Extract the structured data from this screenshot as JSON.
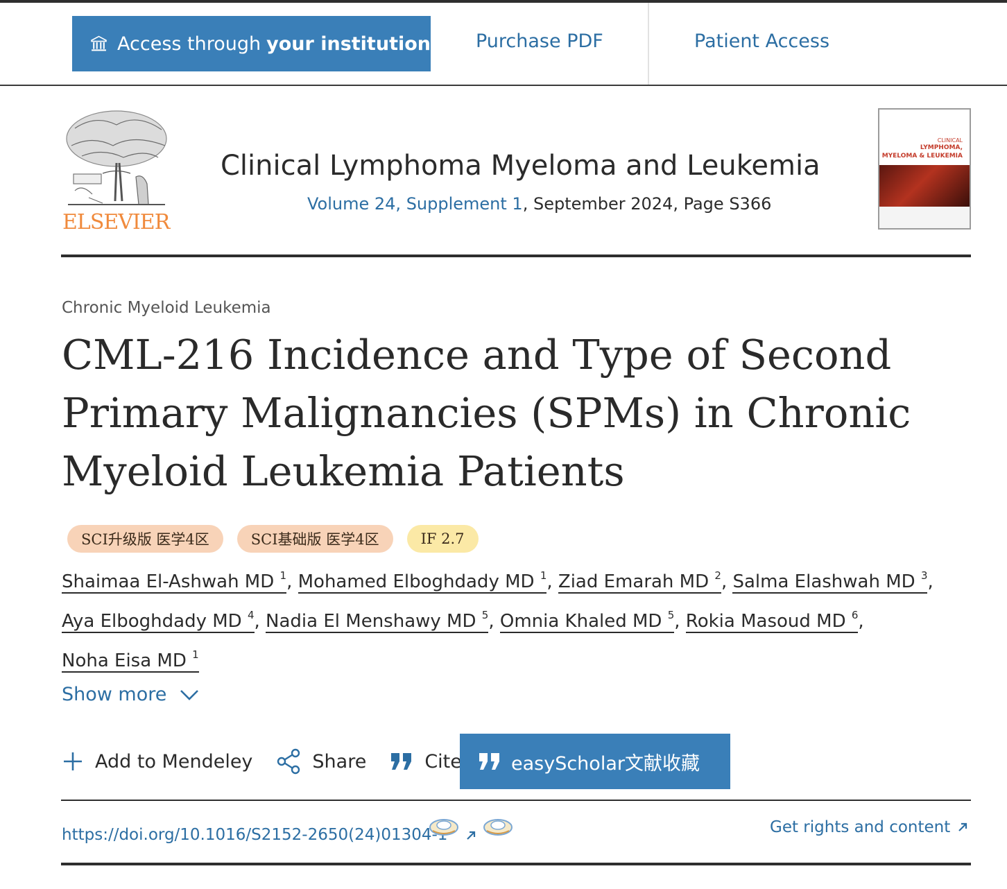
{
  "access_bar": {
    "institution_prefix": "Access through",
    "institution_bold": "your institution",
    "purchase_pdf": "Purchase PDF",
    "patient_access": "Patient Access"
  },
  "journal": {
    "publisher": "ELSEVIER",
    "title": "Clinical Lymphoma Myeloma and Leukemia",
    "volume_link": "Volume 24, Supplement 1",
    "meta_rest": ", September 2024, Page S366",
    "cover": {
      "line1": "CLINICAL",
      "line2": "LYMPHOMA,",
      "line3": "MYELOMA & LEUKEMIA"
    }
  },
  "article": {
    "section": "Chronic Myeloid Leukemia",
    "title": "CML-216 Incidence and Type of Second Primary Malignancies (SPMs) in Chronic Myeloid Leukemia Patients",
    "badges": [
      {
        "label": "SCI升级版 医学4区",
        "color": "#f8d3b8"
      },
      {
        "label": "SCI基础版 医学4区",
        "color": "#f8d3b8"
      },
      {
        "label": "IF 2.7",
        "color": "#fbe9a6"
      }
    ],
    "authors": [
      {
        "name": "Shaimaa El-Ashwah MD",
        "sup": "1"
      },
      {
        "name": "Mohamed Elboghdady MD",
        "sup": "1"
      },
      {
        "name": "Ziad Emarah MD",
        "sup": "2"
      },
      {
        "name": "Salma Elashwah MD",
        "sup": "3"
      },
      {
        "name": "Aya Elboghdady MD",
        "sup": "4"
      },
      {
        "name": "Nadia El Menshawy MD",
        "sup": "5"
      },
      {
        "name": "Omnia Khaled MD",
        "sup": "5"
      },
      {
        "name": "Rokia Masoud MD",
        "sup": "6"
      },
      {
        "name": "Noha Eisa MD",
        "sup": "1"
      }
    ],
    "show_more": "Show more"
  },
  "actions": {
    "mendeley": "Add to Mendeley",
    "share": "Share",
    "cite": "Cite",
    "easyscholar": "easyScholar文献收藏"
  },
  "footer": {
    "doi": "https://doi.org/10.1016/S2152-2650(24)01304-1",
    "rights": "Get rights and content"
  },
  "colors": {
    "accent": "#3a7fb8",
    "link": "#2c6ea3",
    "publisher_orange": "#f08a3c"
  }
}
